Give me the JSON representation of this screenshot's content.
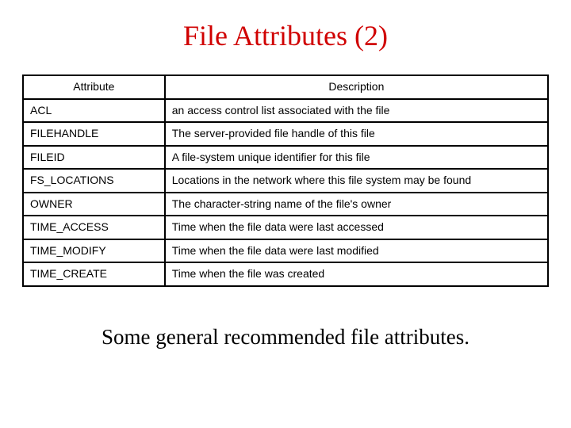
{
  "title": "File Attributes (2)",
  "headers": {
    "attribute": "Attribute",
    "description": "Description"
  },
  "rows": [
    {
      "attr": "ACL",
      "desc": "an access control list associated with the file"
    },
    {
      "attr": "FILEHANDLE",
      "desc": "The server-provided file handle of this file"
    },
    {
      "attr": "FILEID",
      "desc": "A file-system unique identifier for this file"
    },
    {
      "attr": "FS_LOCATIONS",
      "desc": "Locations in the network where this file system may be found"
    },
    {
      "attr": "OWNER",
      "desc": "The character-string name of the file's owner"
    },
    {
      "attr": "TIME_ACCESS",
      "desc": "Time when the file data were last accessed"
    },
    {
      "attr": "TIME_MODIFY",
      "desc": "Time when the file data were last modified"
    },
    {
      "attr": "TIME_CREATE",
      "desc": "Time when the file was created"
    }
  ],
  "caption": "Some general recommended file attributes."
}
